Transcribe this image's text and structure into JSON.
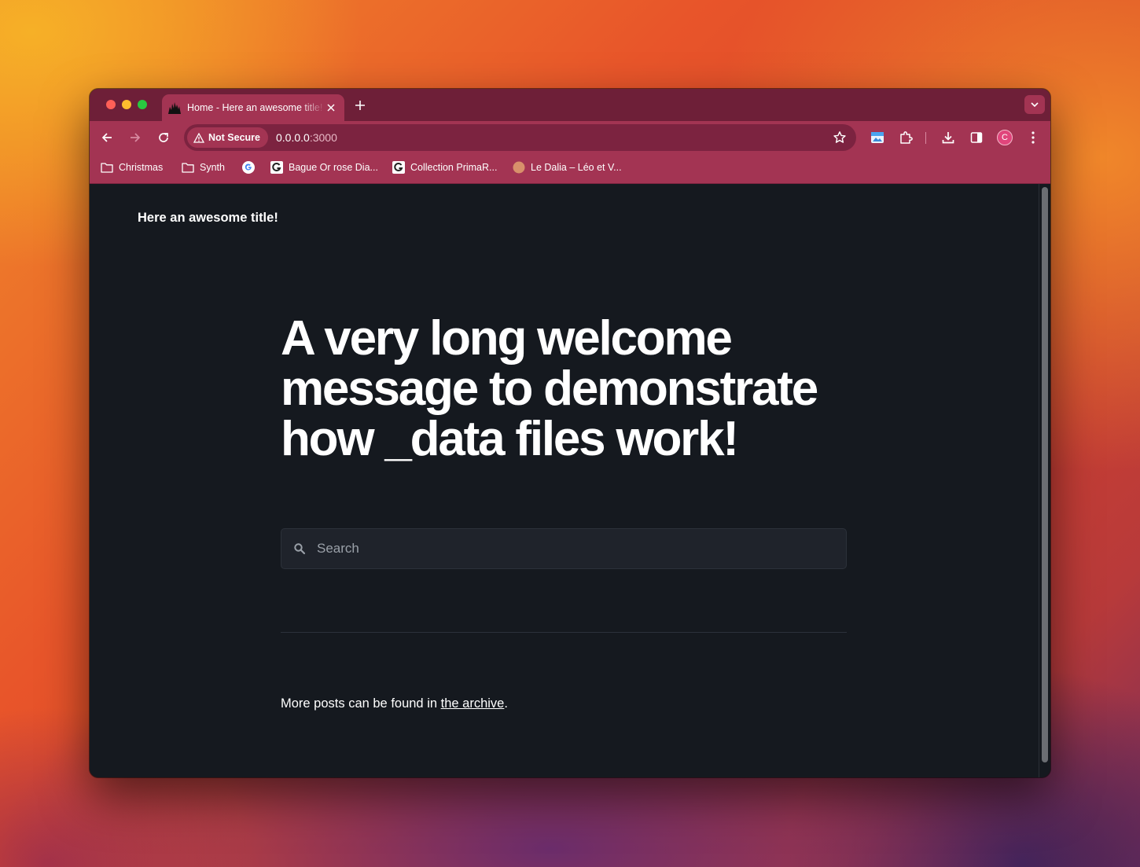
{
  "browser": {
    "tab": {
      "title": "Home - Here an awesome title!"
    },
    "omnibox": {
      "security_label": "Not Secure",
      "url_host": "0.0.0.0",
      "url_port": ":3000"
    },
    "profile_initial": "C",
    "bookmarks": [
      {
        "label": "Christmas",
        "icon": "folder-icon"
      },
      {
        "label": "Synth",
        "icon": "folder-icon"
      },
      {
        "label": "",
        "icon": "google-icon"
      },
      {
        "label": "Bague Or rose Dia...",
        "icon": "g-favicon-icon"
      },
      {
        "label": "Collection PrimaR...",
        "icon": "g-favicon-icon"
      },
      {
        "label": "Le Dalia – Léo et V...",
        "icon": "dalia-favicon-icon"
      }
    ]
  },
  "page": {
    "site_title": "Here an awesome title!",
    "hero_heading": "A very long welcome message to demonstrate how _data files work!",
    "search": {
      "placeholder": "Search",
      "value": ""
    },
    "footer_prefix": "More posts can be found in ",
    "footer_link": "the archive",
    "footer_suffix": "."
  },
  "colors": {
    "tab_strip": "#6e1f38",
    "toolbar": "#a33453",
    "page_background": "#15191f",
    "profile_avatar": "#e0457b"
  }
}
